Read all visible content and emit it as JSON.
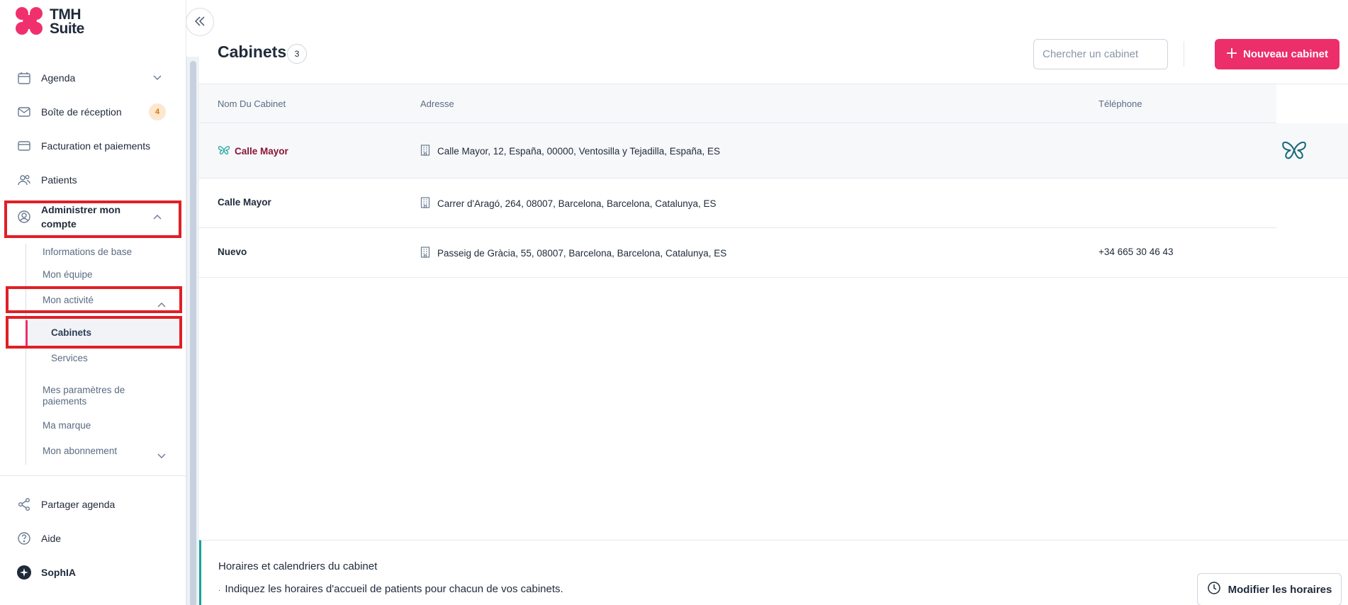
{
  "app": {
    "logo_line1": "TMH",
    "logo_line2": "Suite",
    "brand_color": "#ec2e6a"
  },
  "sidebar": {
    "items": [
      {
        "label": "Agenda"
      },
      {
        "label": "Boîte de réception",
        "badge": "4"
      },
      {
        "label": "Facturation et paiements"
      },
      {
        "label": "Patients"
      },
      {
        "label": "Administrer mon compte"
      }
    ],
    "account_sub": [
      {
        "label": "Informations de base"
      },
      {
        "label": "Mon équipe"
      },
      {
        "label": "Mon activité"
      },
      {
        "label": "Mes paramètres de paiements"
      },
      {
        "label": "Ma marque"
      },
      {
        "label": "Mon abonnement"
      }
    ],
    "activity_sub": [
      {
        "label": "Cabinets"
      },
      {
        "label": "Services"
      }
    ],
    "bottom": [
      {
        "label": "Partager agenda"
      },
      {
        "label": "Aide"
      },
      {
        "label": "SophIA"
      }
    ]
  },
  "main": {
    "title": "Cabinets",
    "count": "3",
    "search_placeholder": "Chercher un cabinet",
    "new_button": "Nouveau cabinet",
    "columns": [
      "Nom Du Cabinet",
      "Adresse",
      "Téléphone"
    ],
    "rows": [
      {
        "name": "Calle Mayor",
        "address": "Calle Mayor, 12, España, 00000, Ventosilla y Tejadilla, España, ES",
        "phone": ""
      },
      {
        "name": "Calle Mayor",
        "address": "Carrer d'Aragó, 264, 08007, Barcelona, Barcelona, Catalunya, ES",
        "phone": ""
      },
      {
        "name": "Nuevo",
        "address": "Passeig de Gràcia, 55, 08007, Barcelona, Barcelona, Catalunya, ES",
        "phone": "+34 665 30 46 43"
      }
    ]
  },
  "footer": {
    "title": "Horaires et calendriers du cabinet",
    "description": "Indiquez les horaires d'accueil de patients pour chacun de vos cabinets.",
    "button": "Modifier les horaires"
  }
}
